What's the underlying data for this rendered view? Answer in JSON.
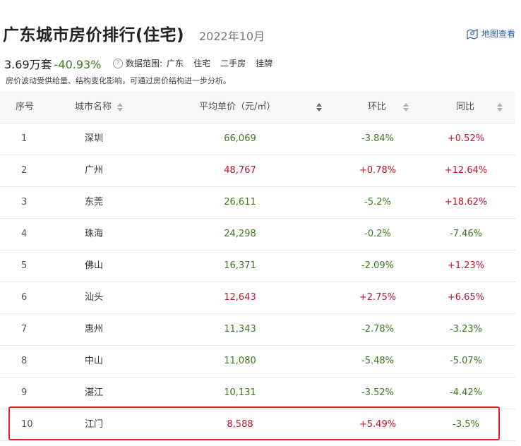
{
  "header": {
    "title": "广东城市房价排行(住宅)",
    "date": "2022年10月",
    "map_link": "地图查看",
    "total": "3.69万套",
    "total_change": "-40.93%",
    "range_label": "数据范围:",
    "range_values": [
      "广东",
      "住宅",
      "二手房",
      "挂牌"
    ],
    "note": "房价波动受供给量、结构变化影响，可通过房价结构进一步分析。"
  },
  "table": {
    "columns": [
      "序号",
      "城市名称",
      "平均单价（元/㎡）",
      "环比",
      "同比"
    ],
    "rows": [
      {
        "rank": "1",
        "city": "深圳",
        "price": "66,069",
        "price_dir": "down",
        "mom": "-3.84%",
        "mom_dir": "down",
        "yoy": "+0.52%",
        "yoy_dir": "up"
      },
      {
        "rank": "2",
        "city": "广州",
        "price": "48,767",
        "price_dir": "up",
        "mom": "+0.78%",
        "mom_dir": "up",
        "yoy": "+12.64%",
        "yoy_dir": "up"
      },
      {
        "rank": "3",
        "city": "东莞",
        "price": "26,611",
        "price_dir": "down",
        "mom": "-5.2%",
        "mom_dir": "down",
        "yoy": "+18.62%",
        "yoy_dir": "up"
      },
      {
        "rank": "4",
        "city": "珠海",
        "price": "24,298",
        "price_dir": "down",
        "mom": "-0.2%",
        "mom_dir": "down",
        "yoy": "-7.46%",
        "yoy_dir": "down"
      },
      {
        "rank": "5",
        "city": "佛山",
        "price": "16,371",
        "price_dir": "down",
        "mom": "-2.09%",
        "mom_dir": "down",
        "yoy": "+1.23%",
        "yoy_dir": "up"
      },
      {
        "rank": "6",
        "city": "汕头",
        "price": "12,643",
        "price_dir": "up",
        "mom": "+2.75%",
        "mom_dir": "up",
        "yoy": "+6.65%",
        "yoy_dir": "up"
      },
      {
        "rank": "7",
        "city": "惠州",
        "price": "11,343",
        "price_dir": "down",
        "mom": "-2.78%",
        "mom_dir": "down",
        "yoy": "-3.23%",
        "yoy_dir": "down"
      },
      {
        "rank": "8",
        "city": "中山",
        "price": "11,080",
        "price_dir": "down",
        "mom": "-5.48%",
        "mom_dir": "down",
        "yoy": "-5.07%",
        "yoy_dir": "down"
      },
      {
        "rank": "9",
        "city": "湛江",
        "price": "10,131",
        "price_dir": "down",
        "mom": "-3.52%",
        "mom_dir": "down",
        "yoy": "-4.42%",
        "yoy_dir": "down"
      },
      {
        "rank": "10",
        "city": "江门",
        "price": "8,588",
        "price_dir": "up",
        "mom": "+5.49%",
        "mom_dir": "up",
        "yoy": "-3.5%",
        "yoy_dir": "down"
      }
    ]
  },
  "colors": {
    "up": "#c0142a",
    "down": "#3d7a1e",
    "highlight": "#e02020",
    "link": "#2b5fb3"
  }
}
